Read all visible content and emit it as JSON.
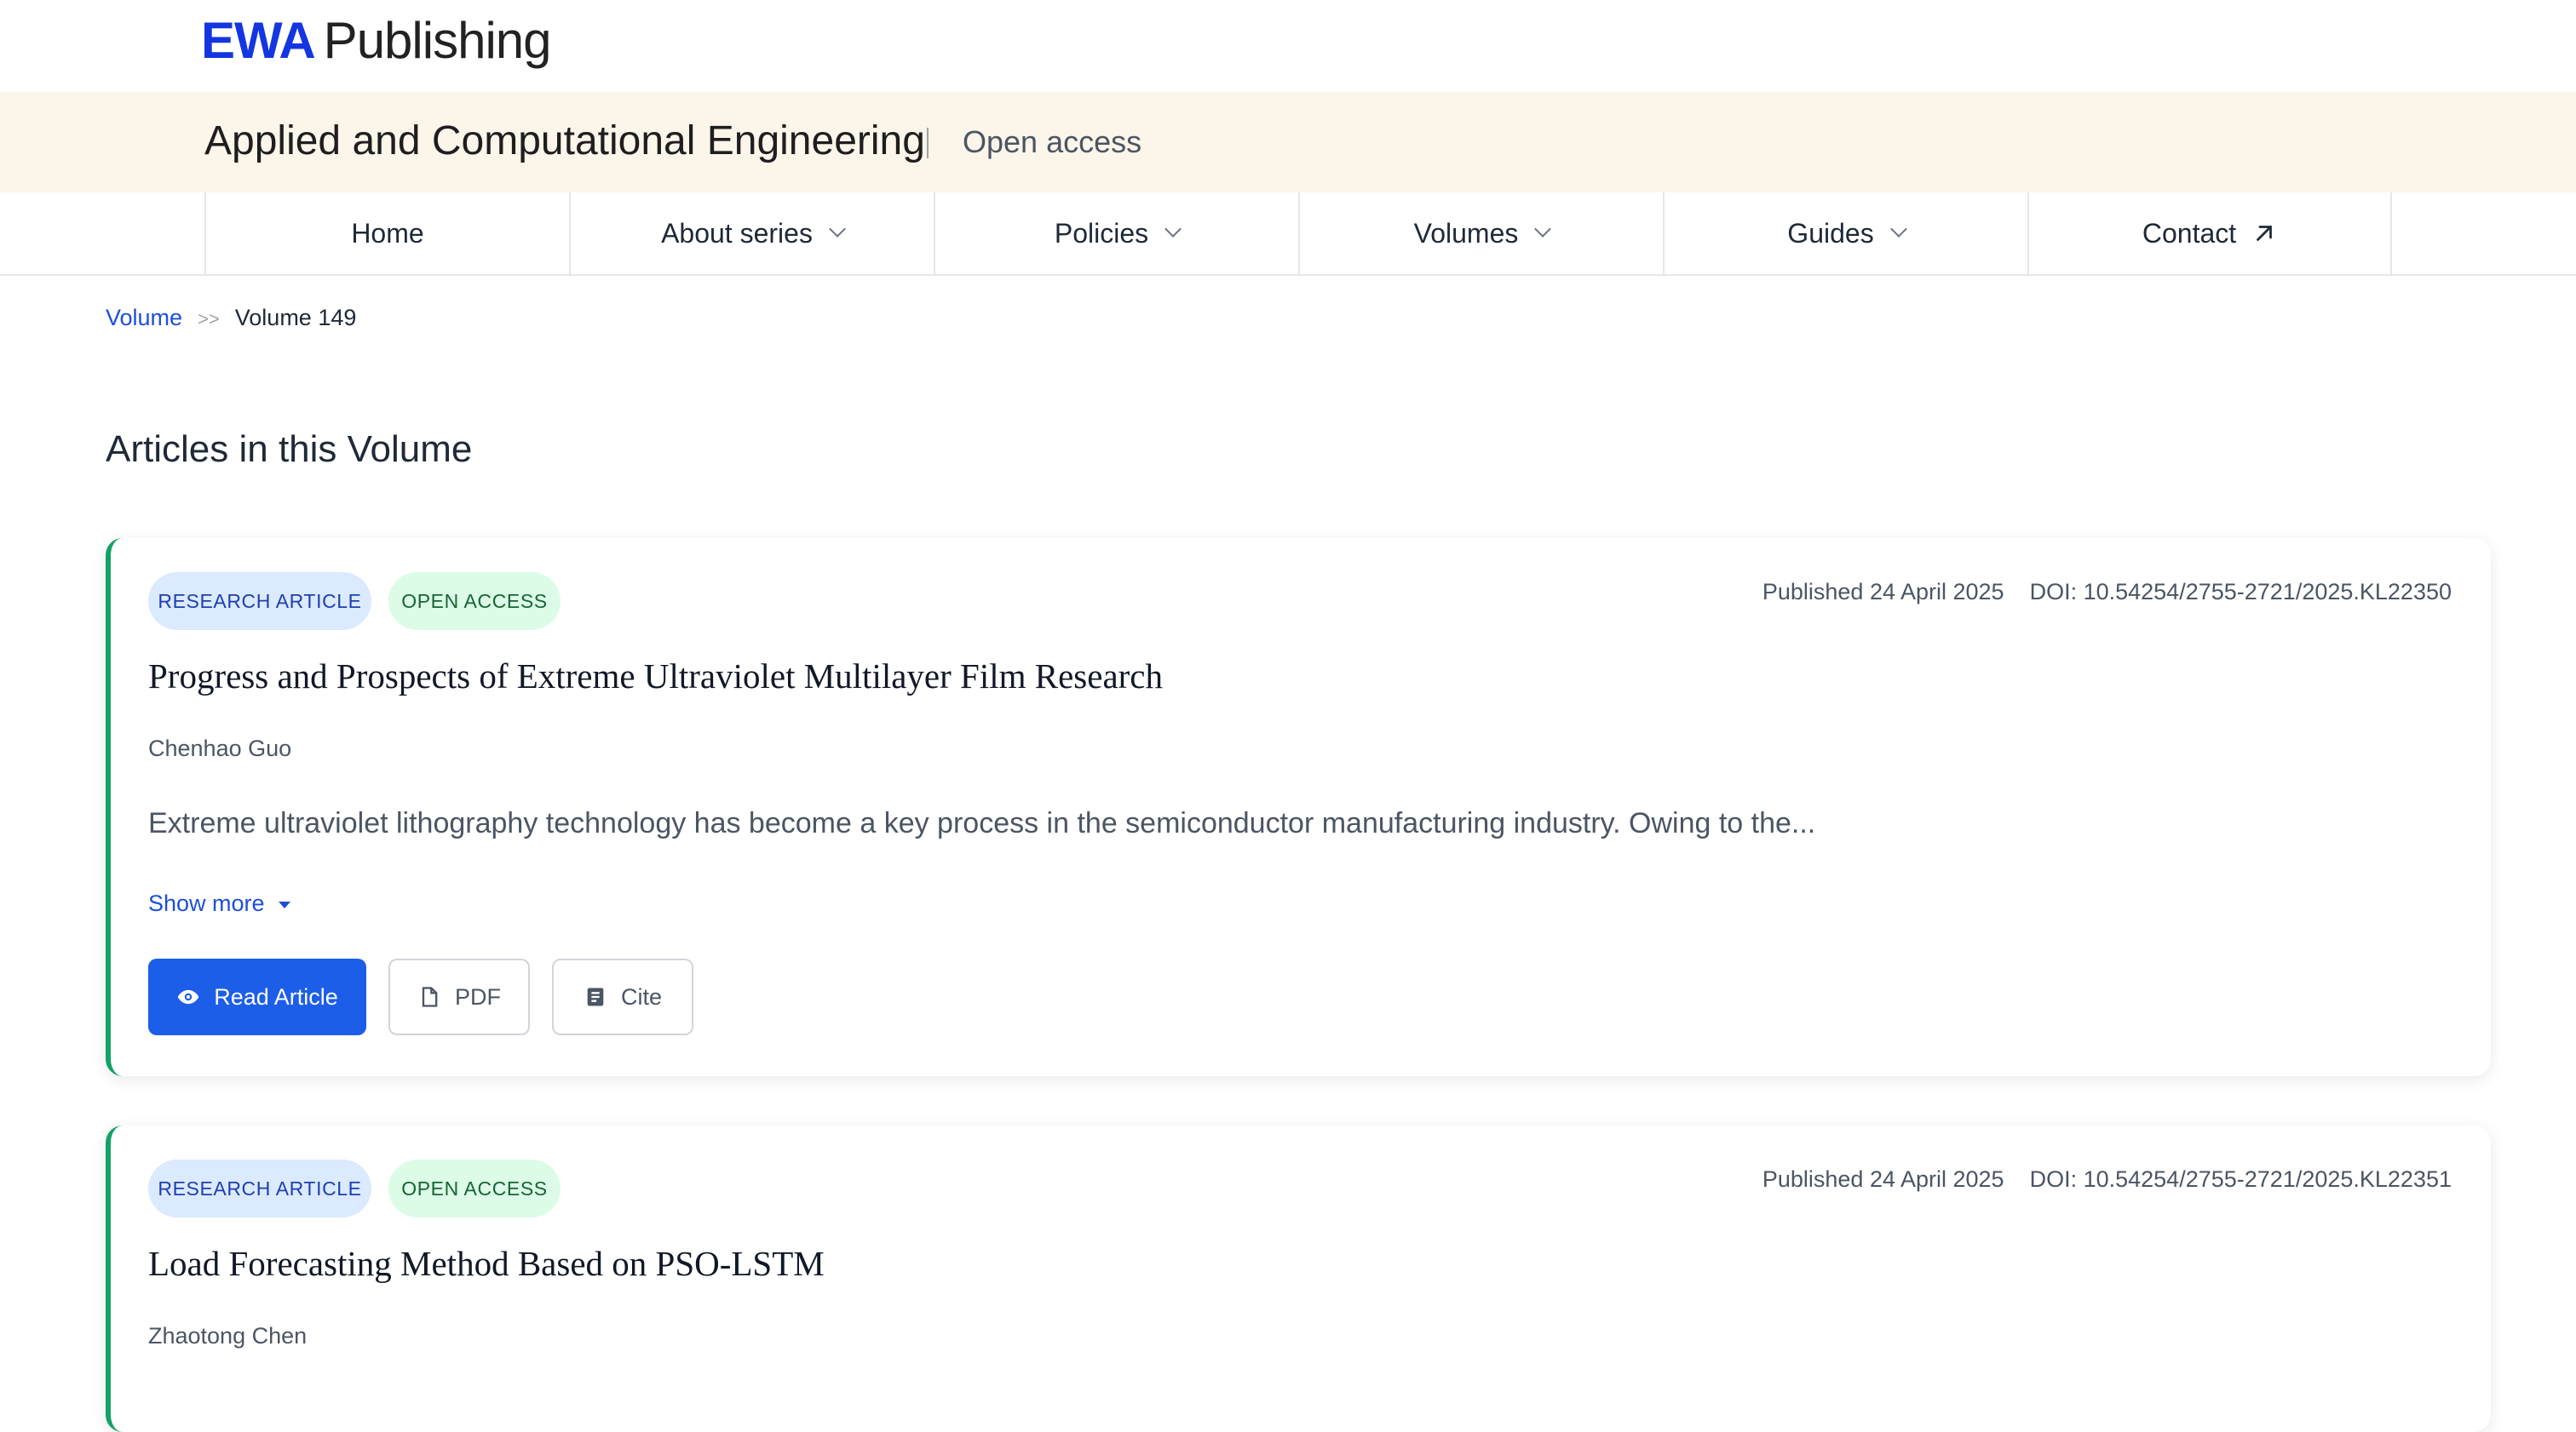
{
  "brand": {
    "name_bold": "EWA",
    "name_rest": "Publishing",
    "accent": "#1336e0"
  },
  "journal": {
    "title": "Applied and Computational Engineering",
    "access": "Open access"
  },
  "nav": {
    "items": [
      {
        "label": "Home"
      },
      {
        "label": "About series"
      },
      {
        "label": "Policies"
      },
      {
        "label": "Volumes"
      },
      {
        "label": "Guides"
      },
      {
        "label": "Contact"
      }
    ]
  },
  "breadcrumb": {
    "link": "Volume",
    "separator": ">>",
    "current": "Volume 149"
  },
  "section": {
    "title": "Articles in this Volume"
  },
  "articles": [
    {
      "badge_type": "RESEARCH ARTICLE",
      "badge_access": "OPEN ACCESS",
      "published": "Published 24 April 2025",
      "doi": "DOI: 10.54254/2755-2721/2025.KL22350",
      "title": "Progress and Prospects of Extreme Ultraviolet Multilayer Film Research",
      "author": "Chenhao Guo",
      "abstract": "Extreme ultraviolet lithography technology has become a key process in the semiconductor manufacturing industry. Owing to the...",
      "show_more": "Show more",
      "buttons": {
        "read": "Read Article",
        "pdf": "PDF",
        "cite": "Cite"
      }
    },
    {
      "badge_type": "RESEARCH ARTICLE",
      "badge_access": "OPEN ACCESS",
      "published": "Published 24 April 2025",
      "doi": "DOI: 10.54254/2755-2721/2025.KL22351",
      "title": "Load Forecasting Method Based on PSO-LSTM",
      "author": "Zhaotong Chen"
    }
  ],
  "colors": {
    "primary_button": "#1d5ee8",
    "card_accent": "#12a265",
    "journal_band": "#fcf5ea"
  }
}
